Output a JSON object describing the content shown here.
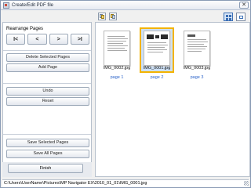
{
  "window": {
    "title": "Create/Edit PDF file",
    "close_symbol": "✕"
  },
  "left_panel": {
    "rearrange_label": "Rearrange Pages",
    "nav": {
      "first": "I<",
      "prev": "<",
      "next": ">",
      "last": ">I"
    },
    "delete_selected": "Delete Selected Pages",
    "add_page": "Add Page",
    "undo": "Undo",
    "reset": "Reset",
    "save_selected": "Save Selected Pages",
    "save_all": "Save All Pages",
    "finish": "Finish"
  },
  "pages": [
    {
      "file": "IMG_0002.jpg",
      "label": "page 1",
      "selected": false
    },
    {
      "file": "IMG_0001.jpg",
      "label": "page 2",
      "selected": true
    },
    {
      "file": "IMG_0003.jpg",
      "label": "page 3",
      "selected": false
    }
  ],
  "status_bar": {
    "path": "C:\\Users\\UserName\\Pictures\\MP Navigator EX\\2010_01_01\\IMG_0001.jpg"
  },
  "colors": {
    "selection_border": "#f3b300",
    "selection_fill": "#cde0f6",
    "page_link": "#2b63c9"
  }
}
